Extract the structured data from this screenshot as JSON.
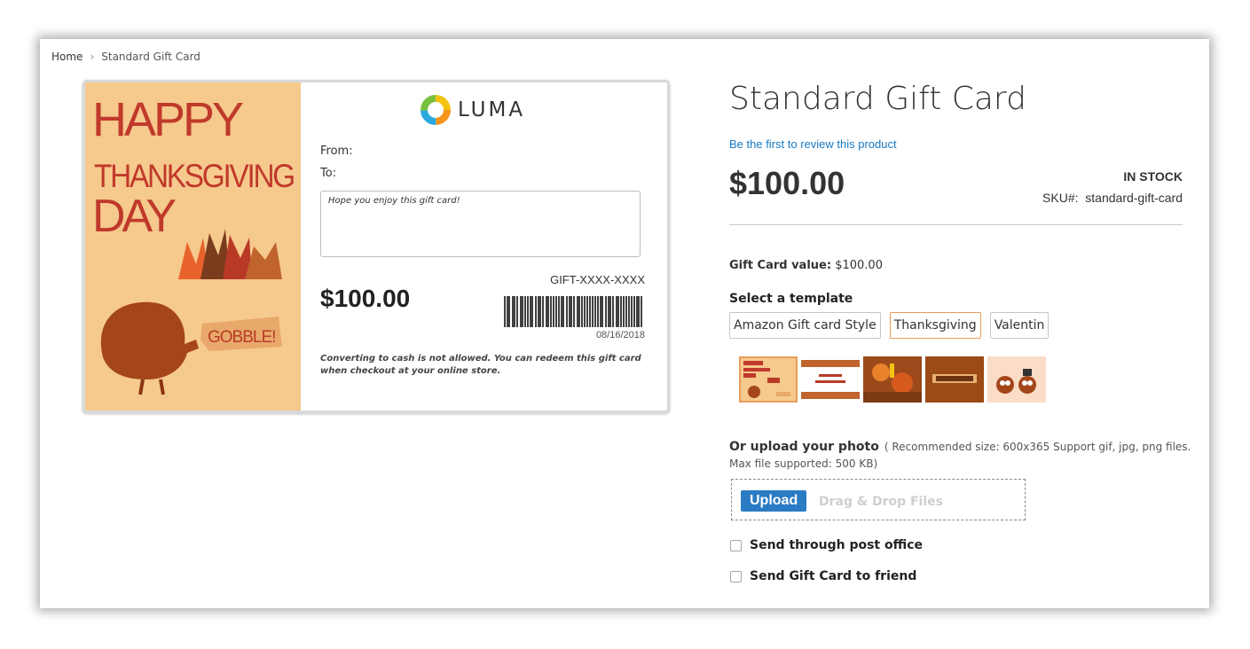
{
  "breadcrumb": {
    "home": "Home",
    "separator": "›",
    "current": "Standard Gift Card"
  },
  "card_preview": {
    "logo_text": "LUMA",
    "from_label": "From:",
    "to_label": "To:",
    "message": "Hope you enjoy this gift card!",
    "gift_code": "GIFT-XXXX-XXXX",
    "price": "$100.00",
    "date": "08/16/2018",
    "note": "Converting to cash is not allowed. You can redeem this gift card when checkout at your online store.",
    "art": {
      "line1": "HAPPY",
      "line2": "THANKSGIVING",
      "line3": "DAY",
      "bubble": "GOBBLE!"
    }
  },
  "product": {
    "title": "Standard Gift Card",
    "review_link": "Be the first to review this product",
    "price": "$100.00",
    "stock": "IN STOCK",
    "sku_label": "SKU#:",
    "sku_value": "standard-gift-card"
  },
  "options": {
    "value_label": "Gift Card value:",
    "value": "$100.00",
    "template_label": "Select a template",
    "templates": [
      "Amazon Gift card Style",
      "Thanksgiving",
      "Valentin"
    ],
    "active_template": "Thanksgiving",
    "thumbnails": [
      "thumb-happy-thanksgiving",
      "thumb-happy-thanksgiving-leaves",
      "thumb-autumn-candles",
      "thumb-thanksgiving-banner",
      "thumb-turkeys"
    ]
  },
  "upload": {
    "title": "Or upload your photo",
    "hint1": "( Recommended size: 600x365 Support gif, jpg, png files.",
    "hint2": "Max file supported: 500 KB)",
    "button": "Upload",
    "drag_text": "Drag & Drop Files"
  },
  "checkboxes": {
    "post_office": "Send through post office",
    "to_friend": "Send Gift Card to friend"
  },
  "colors": {
    "link": "#1979c3",
    "upload_button": "#2b7bc4",
    "active_border": "#e79d5a",
    "card_bg": "#f6c98d"
  }
}
